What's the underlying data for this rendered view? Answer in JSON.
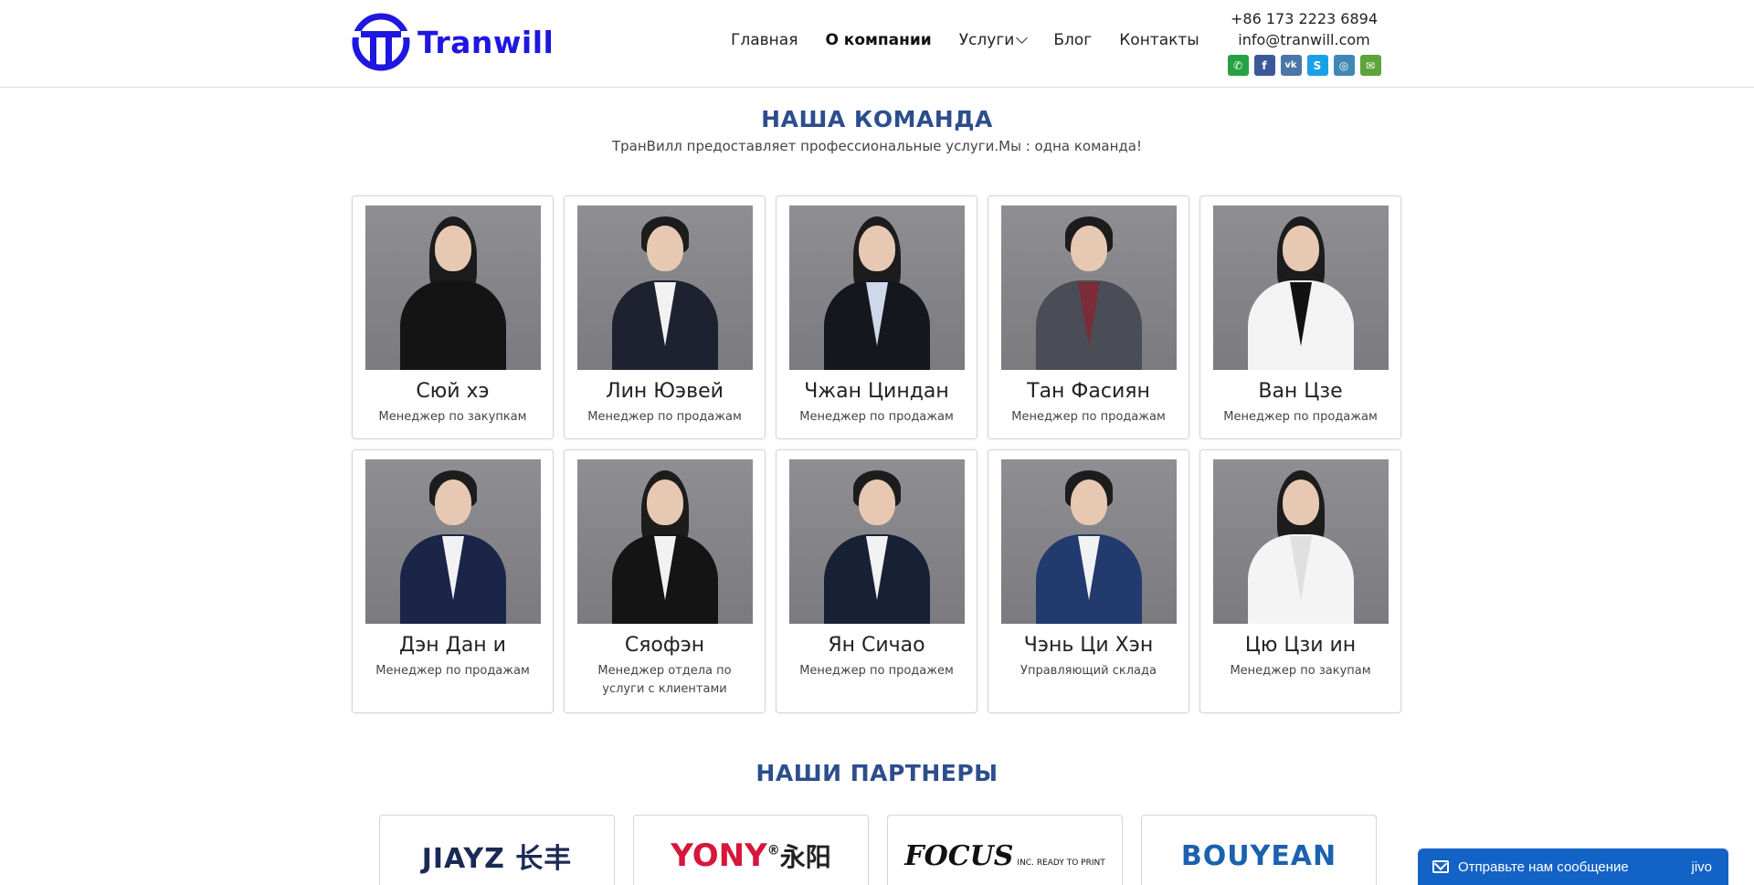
{
  "brand": {
    "name": "Tranwill",
    "color": "#1f16e0"
  },
  "nav": {
    "items": [
      {
        "label": "Главная",
        "active": false
      },
      {
        "label": "О компании",
        "active": true
      },
      {
        "label": "Услуги",
        "active": false,
        "dropdown": true
      },
      {
        "label": "Блог",
        "active": false
      },
      {
        "label": "Контакты",
        "active": false
      }
    ]
  },
  "contact": {
    "phone": "+86 173 2223 6894",
    "email": "info@tranwill.com",
    "socials": [
      {
        "icon": "whatsapp-icon",
        "color": "#25a244"
      },
      {
        "icon": "facebook-icon",
        "color": "#3b5998"
      },
      {
        "icon": "vk-icon",
        "color": "#4a76a8"
      },
      {
        "icon": "skype-icon",
        "color": "#1aa0e8"
      },
      {
        "icon": "instagram-icon",
        "color": "#3f87b5"
      },
      {
        "icon": "mail-icon",
        "color": "#5ea33b"
      }
    ]
  },
  "team": {
    "title": "НАША КОМАНДА",
    "subtitle": "ТранВилл предоставляет профессиональные услуги.Мы : одна команда!",
    "members": [
      {
        "name": "Сюй хэ",
        "role": "Менеджер по закупкам"
      },
      {
        "name": "Лин Юэвей",
        "role": "Менеджер по продажам"
      },
      {
        "name": "Чжан Циндан",
        "role": "Менеджер по продажам"
      },
      {
        "name": "Тан Фасиян",
        "role": "Менеджер по продажам"
      },
      {
        "name": "Ван Цзе",
        "role": "Менеджер по продажам"
      },
      {
        "name": "Дэн Дан и",
        "role": "Менеджер по продажам"
      },
      {
        "name": "Сяофэн",
        "role": "Менеджер отдела по услуги с клиентами"
      },
      {
        "name": "Ян Сичао",
        "role": "Менеджер по продажем"
      },
      {
        "name": "Чэнь Ци Хэн",
        "role": "Управляющий склада"
      },
      {
        "name": "Цю Цзи ин",
        "role": "Менеджер по закупам"
      }
    ]
  },
  "partners": {
    "title": "НАШИ ПАРТНЕРЫ",
    "logos": [
      {
        "text": "JIAYZ",
        "cn": "长丰"
      },
      {
        "text": "YONY",
        "mark": "®",
        "cn": "永阳"
      },
      {
        "text": "FOCUS",
        "sub": "INC. READY TO PRINT"
      },
      {
        "text": "BOUYEAN"
      }
    ]
  },
  "chat": {
    "label": "Отправьте нам сообщение",
    "brand": "jivo"
  }
}
